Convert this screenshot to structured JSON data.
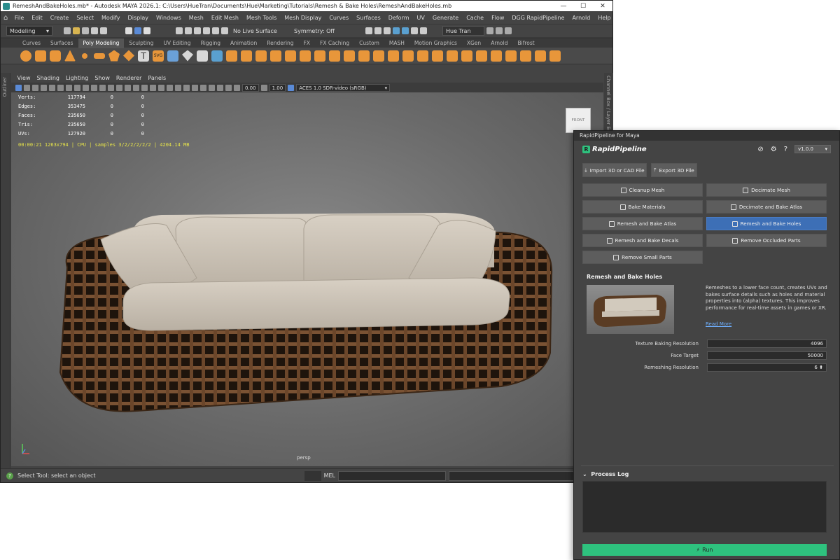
{
  "window": {
    "title": "RemeshAndBakeHoles.mb* - Autodesk MAYA 2026.1: C:\\Users\\HueTran\\Documents\\Hue\\Marketing\\Tutorials\\Remesh & Bake Holes\\RemeshAndBakeHoles.mb",
    "minimize": "—",
    "maximize": "☐",
    "close": "✕"
  },
  "menubar": [
    "File",
    "Edit",
    "Create",
    "Select",
    "Modify",
    "Display",
    "Windows",
    "Mesh",
    "Edit Mesh",
    "Mesh Tools",
    "Mesh Display",
    "Curves",
    "Surfaces",
    "Deform",
    "UV",
    "Generate",
    "Cache",
    "Flow",
    "DGG RapidPipeline",
    "Arnold",
    "Help"
  ],
  "statusline": {
    "workspace": "Modeling",
    "live_surface": "No Live Surface",
    "symmetry": "Symmetry: Off",
    "user": "Hue Tran"
  },
  "shelf_tabs": [
    "Curves",
    "Surfaces",
    "Poly Modeling",
    "Sculpting",
    "UV Editing",
    "Rigging",
    "Animation",
    "Rendering",
    "FX",
    "FX Caching",
    "Custom",
    "MASH",
    "Motion Graphics",
    "XGen",
    "Arnold",
    "Bifrost"
  ],
  "shelf_active": "Poly Modeling",
  "side_labels": {
    "left": "Outliner",
    "right": "Channel Box / Layer Editor"
  },
  "panel_menu": [
    "View",
    "Shading",
    "Lighting",
    "Show",
    "Renderer",
    "Panels"
  ],
  "panel_tools": {
    "exposure": "0.00",
    "gamma": "1.00",
    "colorspace": "ACES 1.0 SDR-video (sRGB)"
  },
  "hud": {
    "rows": [
      {
        "label": "Verts:",
        "v1": "117794",
        "v2": "0",
        "v3": "0"
      },
      {
        "label": "Edges:",
        "v1": "353475",
        "v2": "0",
        "v3": "0"
      },
      {
        "label": "Faces:",
        "v1": "235650",
        "v2": "0",
        "v3": "0"
      },
      {
        "label": "Tris:",
        "v1": "235650",
        "v2": "0",
        "v3": "0"
      },
      {
        "label": "UVs:",
        "v1": "127920",
        "v2": "0",
        "v3": "0"
      }
    ],
    "render_line": "00:00:21  1263x794  |  CPU  |  samples 3/2/2/2/2/2  |  4204.14 MB"
  },
  "viewcube": "FRONT",
  "camera": "persp",
  "helpline": {
    "text": "Select Tool: select an object",
    "mel": "MEL"
  },
  "rapid": {
    "window_title": "RapidPipeline for Maya",
    "logo": "RapidPipeline",
    "version": "v1.0.0",
    "import_btn": "Import 3D or CAD File",
    "export_btn": "Export 3D File",
    "actions": [
      {
        "label": "Cleanup Mesh"
      },
      {
        "label": "Decimate Mesh"
      },
      {
        "label": "Bake Materials"
      },
      {
        "label": "Decimate and Bake Atlas"
      },
      {
        "label": "Remesh and Bake Atlas"
      },
      {
        "label": "Remesh and Bake Holes"
      },
      {
        "label": "Remesh and Bake Decals"
      },
      {
        "label": "Remove Occluded Parts"
      },
      {
        "label": "Remove Small Parts"
      }
    ],
    "active_action": "Remesh and Bake Holes",
    "section_title": "Remesh and Bake Holes",
    "description": "Remeshes to a lower face count, creates UVs and bakes surface details such as holes and material properties into (alpha) textures. This improves performance for real-time assets in games or XR.",
    "read_more": "Read More",
    "params": [
      {
        "label": "Texture Baking Resolution",
        "value": "4096"
      },
      {
        "label": "Face Target",
        "value": "50000"
      },
      {
        "label": "Remeshing Resolution",
        "value": "6"
      }
    ],
    "process_log": "Process Log",
    "run": "Run"
  }
}
